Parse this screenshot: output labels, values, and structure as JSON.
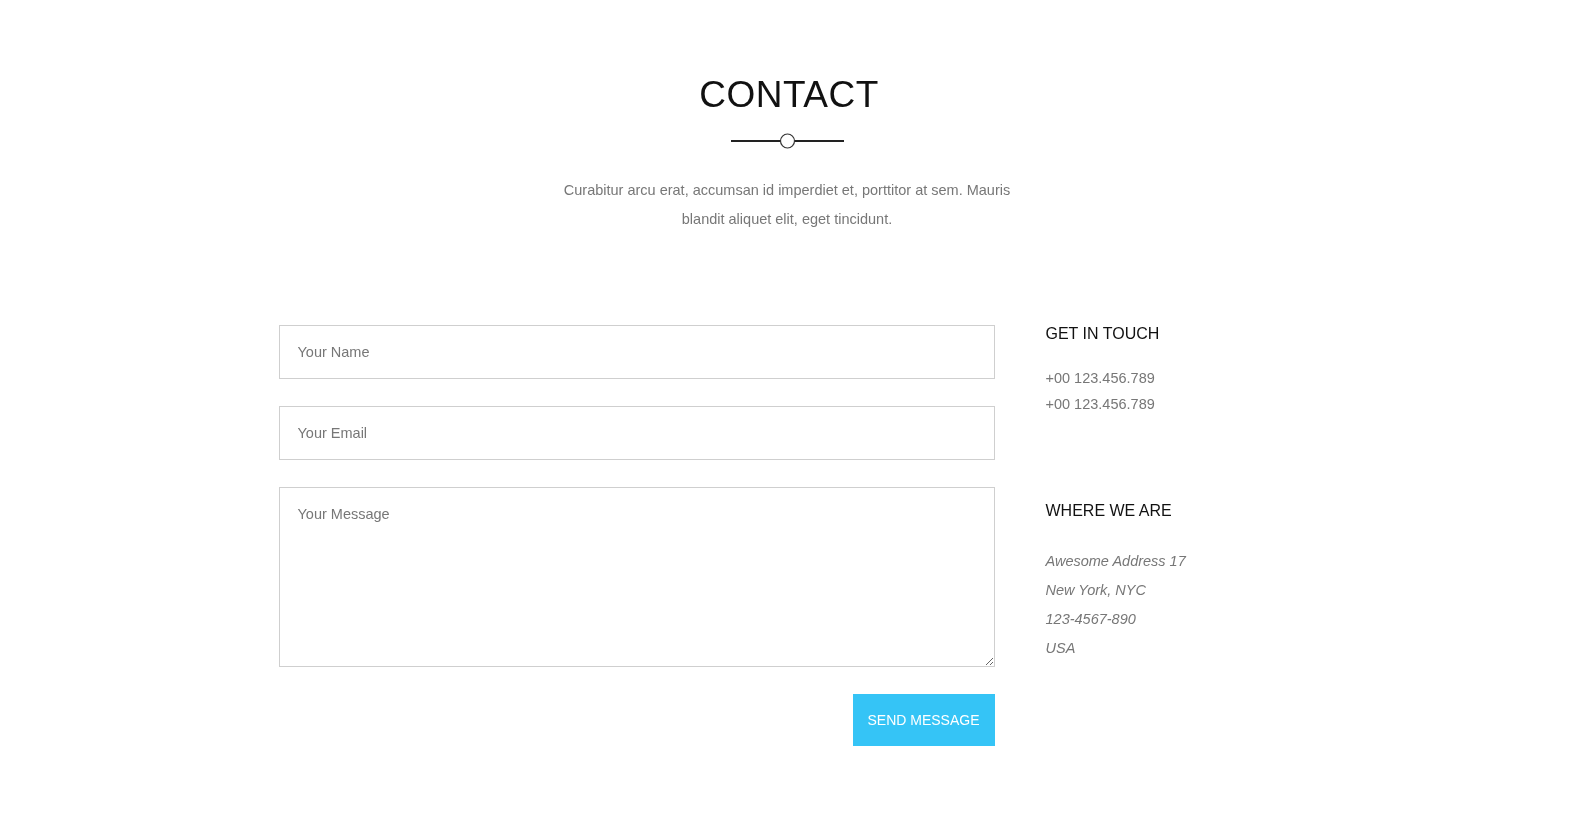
{
  "header": {
    "title": "CONTACT",
    "intro": "Curabitur arcu erat, accumsan id imperdiet et, porttitor at sem. Mauris blandit aliquet elit, eget tincidunt."
  },
  "form": {
    "fields": [
      {
        "kind": "input",
        "placeholder": "Your Name"
      },
      {
        "kind": "input",
        "placeholder": "Your Email"
      },
      {
        "kind": "textarea",
        "placeholder": "Your Message"
      }
    ],
    "submit": "SEND MESSAGE"
  },
  "info": [
    {
      "kind": "phones",
      "heading": "GET IN TOUCH",
      "lines": [
        "+00 123.456.789",
        "+00 123.456.789"
      ]
    },
    {
      "kind": "address",
      "heading": "WHERE WE ARE",
      "lines": [
        "Awesome Address 17",
        "New York, NYC",
        "123-4567-890",
        "USA"
      ]
    }
  ]
}
